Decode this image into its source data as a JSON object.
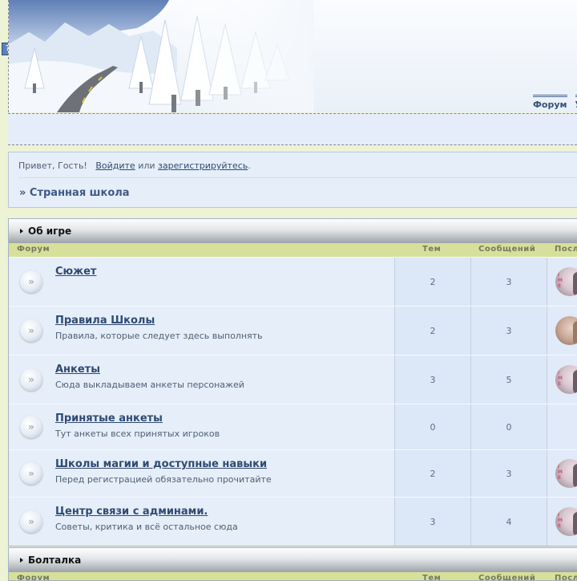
{
  "help_icon": {
    "glyph": "?"
  },
  "header": {
    "nav": [
      "Форум",
      "Уч"
    ]
  },
  "welcome": {
    "greeting": "Привет, Гость!",
    "login": "Войдите",
    "or": "или",
    "register": "зарегистрируйтесь",
    "period": ".",
    "breadcrumb": "» Странная школа"
  },
  "columns": {
    "forum": "Форум",
    "topics": "Тем",
    "posts": "Сообщений",
    "last": "Посл"
  },
  "row_icon_glyph": "»",
  "categories": [
    {
      "title": "Об игре",
      "forums": [
        {
          "title": "Сюжет",
          "desc": "",
          "topics": "2",
          "posts": "3"
        },
        {
          "title": "Правила Школы",
          "desc": "Правила, которые следует здесь выполнять",
          "topics": "2",
          "posts": "3"
        },
        {
          "title": "Анкеты",
          "desc": "Сюда выкладываем анкеты персонажей",
          "topics": "3",
          "posts": "5"
        },
        {
          "title": "Принятые анкеты",
          "desc": "Тут анкеты всех принятых игроков",
          "topics": "0",
          "posts": "0"
        },
        {
          "title": "Школы магии и доступные навыки",
          "desc": "Перед регистрацией обязательно прочитайте",
          "topics": "2",
          "posts": "3"
        },
        {
          "title": "Центр связи с админами.",
          "desc": "Советы, критика и всё остальное сюда",
          "topics": "3",
          "posts": "4"
        }
      ]
    },
    {
      "title": "Болталка",
      "forums": []
    }
  ]
}
